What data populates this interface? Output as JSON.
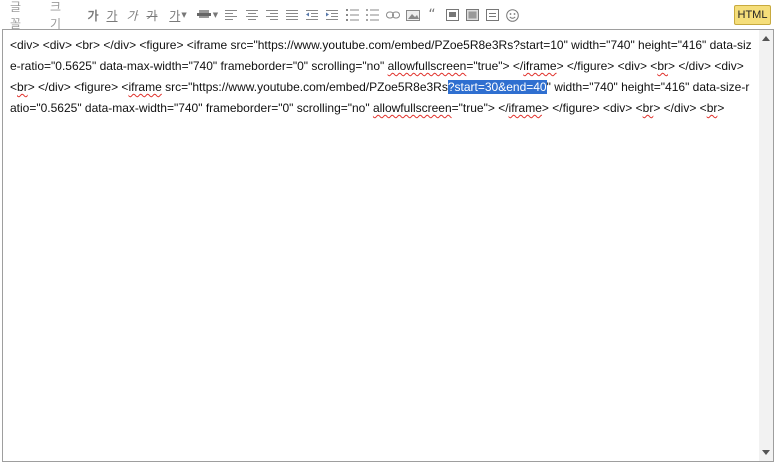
{
  "toolbar": {
    "font_label": "글꼴",
    "size_label": "크기",
    "bold_glyph": "가",
    "underline_glyph": "가",
    "italic_glyph": "가",
    "strike_glyph": "가",
    "fontcolor_glyph": "가",
    "quote_glyph": "“",
    "html_label": "HTML",
    "icons": [
      "bold-icon",
      "underline-icon",
      "italic-icon",
      "strikethrough-icon",
      "font-color-icon",
      "background-color-icon",
      "align-left-icon",
      "align-center-icon",
      "align-right-icon",
      "align-justify-icon",
      "outdent-icon",
      "indent-icon",
      "ordered-list-icon",
      "bullet-list-icon",
      "link-icon",
      "image-icon",
      "quote-icon",
      "video-icon",
      "photo-icon",
      "box-icon",
      "emoji-icon"
    ]
  },
  "editor": {
    "segments": [
      {
        "text": "<div> <div> <br> </div> <figure> <iframe src=\"https://www.youtube.com/embed/PZoe5R8e3Rs?start=10\" width=\"740\" height=\"416\" data-size-ratio=\"0.5625\" data-max-width=\"740\" frameborder=\"0\" scrolling=\"no\" "
      },
      {
        "text": "allowfullscreen",
        "style": "squiggle"
      },
      {
        "text": "=\"true\"> </"
      },
      {
        "text": "iframe",
        "style": "squiggle"
      },
      {
        "text": "> </figure> <div> <"
      },
      {
        "text": "br",
        "style": "squiggle"
      },
      {
        "text": "> </div> <div> <"
      },
      {
        "text": "br",
        "style": "squiggle"
      },
      {
        "text": "> </div> <figure> <"
      },
      {
        "text": "iframe",
        "style": "squiggle"
      },
      {
        "text": " src=\"https://www.youtube.com/embed/PZoe5R8e3Rs"
      },
      {
        "text": "?start=30&end=40",
        "style": "selected"
      },
      {
        "text": "\" width=\"740\" height=\"416\" data-size-ratio=\"0.5625\" data-max-width=\"740\" frameborder=\"0\" scrolling=\"no\" "
      },
      {
        "text": "allowfullscreen",
        "style": "squiggle"
      },
      {
        "text": "=\"true\"> </"
      },
      {
        "text": "iframe",
        "style": "squiggle"
      },
      {
        "text": "> </figure> <div> <"
      },
      {
        "text": "br",
        "style": "squiggle"
      },
      {
        "text": "> </div> <"
      },
      {
        "text": "br",
        "style": "squiggle"
      },
      {
        "text": ">"
      }
    ]
  },
  "colors": {
    "selection": "#2f6fd0",
    "html_button": "#f5de7a",
    "spellcheck": "#e0302a"
  }
}
